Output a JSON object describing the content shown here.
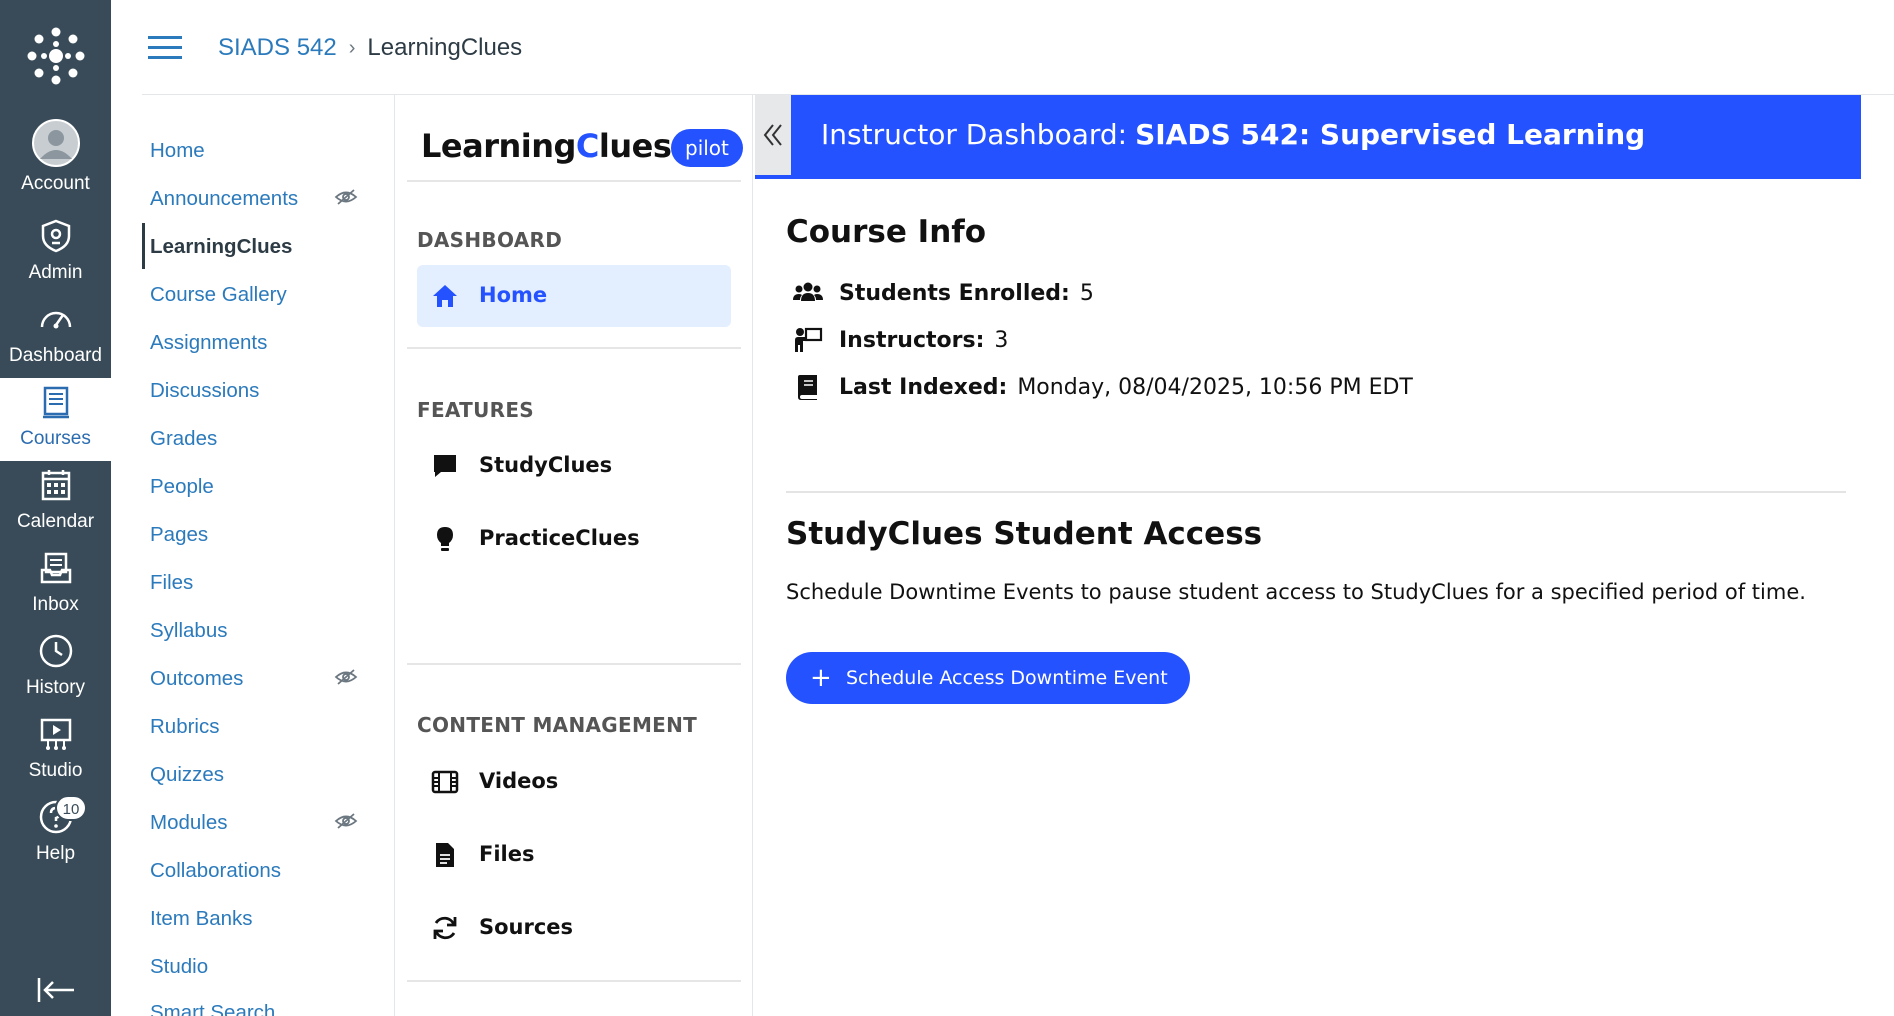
{
  "global_nav": {
    "items": [
      {
        "label": "Account",
        "icon": "account-avatar-icon"
      },
      {
        "label": "Admin",
        "icon": "admin-shield-icon"
      },
      {
        "label": "Dashboard",
        "icon": "dashboard-gauge-icon"
      },
      {
        "label": "Courses",
        "icon": "courses-book-icon"
      },
      {
        "label": "Calendar",
        "icon": "calendar-icon"
      },
      {
        "label": "Inbox",
        "icon": "inbox-icon"
      },
      {
        "label": "History",
        "icon": "history-clock-icon"
      },
      {
        "label": "Studio",
        "icon": "studio-icon"
      },
      {
        "label": "Help",
        "icon": "help-icon",
        "badge": "10"
      }
    ],
    "active": "Courses"
  },
  "breadcrumb": {
    "course": "SIADS 542",
    "current": "LearningClues"
  },
  "course_nav": {
    "items": [
      {
        "label": "Home"
      },
      {
        "label": "Announcements",
        "hidden_icon": true
      },
      {
        "label": "LearningClues",
        "active": true
      },
      {
        "label": "Course Gallery"
      },
      {
        "label": "Assignments"
      },
      {
        "label": "Discussions"
      },
      {
        "label": "Grades"
      },
      {
        "label": "People"
      },
      {
        "label": "Pages"
      },
      {
        "label": "Files"
      },
      {
        "label": "Syllabus"
      },
      {
        "label": "Outcomes",
        "hidden_icon": true
      },
      {
        "label": "Rubrics"
      },
      {
        "label": "Quizzes"
      },
      {
        "label": "Modules",
        "hidden_icon": true
      },
      {
        "label": "Collaborations"
      },
      {
        "label": "Item Banks"
      },
      {
        "label": "Studio"
      },
      {
        "label": "Smart Search"
      }
    ]
  },
  "lc_sidebar": {
    "logo_pre": "Learning",
    "logo_c": "C",
    "logo_post": "lues",
    "pilot_badge": "pilot",
    "sections": {
      "dashboard": "DASHBOARD",
      "features": "FEATURES",
      "content": "CONTENT MANAGEMENT"
    },
    "items": {
      "home": "Home",
      "studyclues": "StudyClues",
      "practiceclues": "PracticeClues",
      "videos": "Videos",
      "files": "Files",
      "sources": "Sources"
    }
  },
  "banner": {
    "prefix": "Instructor Dashboard:",
    "course": "SIADS 542: Supervised Learning"
  },
  "course_info": {
    "title": "Course Info",
    "students_label": "Students Enrolled:",
    "students_value": "5",
    "instructors_label": "Instructors:",
    "instructors_value": "3",
    "indexed_label": "Last Indexed:",
    "indexed_value": "Monday, 08/04/2025, 10:56 PM EDT"
  },
  "access": {
    "title": "StudyClues Student Access",
    "description": "Schedule Downtime Events to pause student access to StudyClues for a specified period of time.",
    "button_label": "Schedule Access Downtime Event"
  },
  "colors": {
    "global_nav_bg": "#394b58",
    "link_blue": "#2b7abc",
    "brand_blue": "#2552ff",
    "active_item_bg": "#e3eeff"
  }
}
